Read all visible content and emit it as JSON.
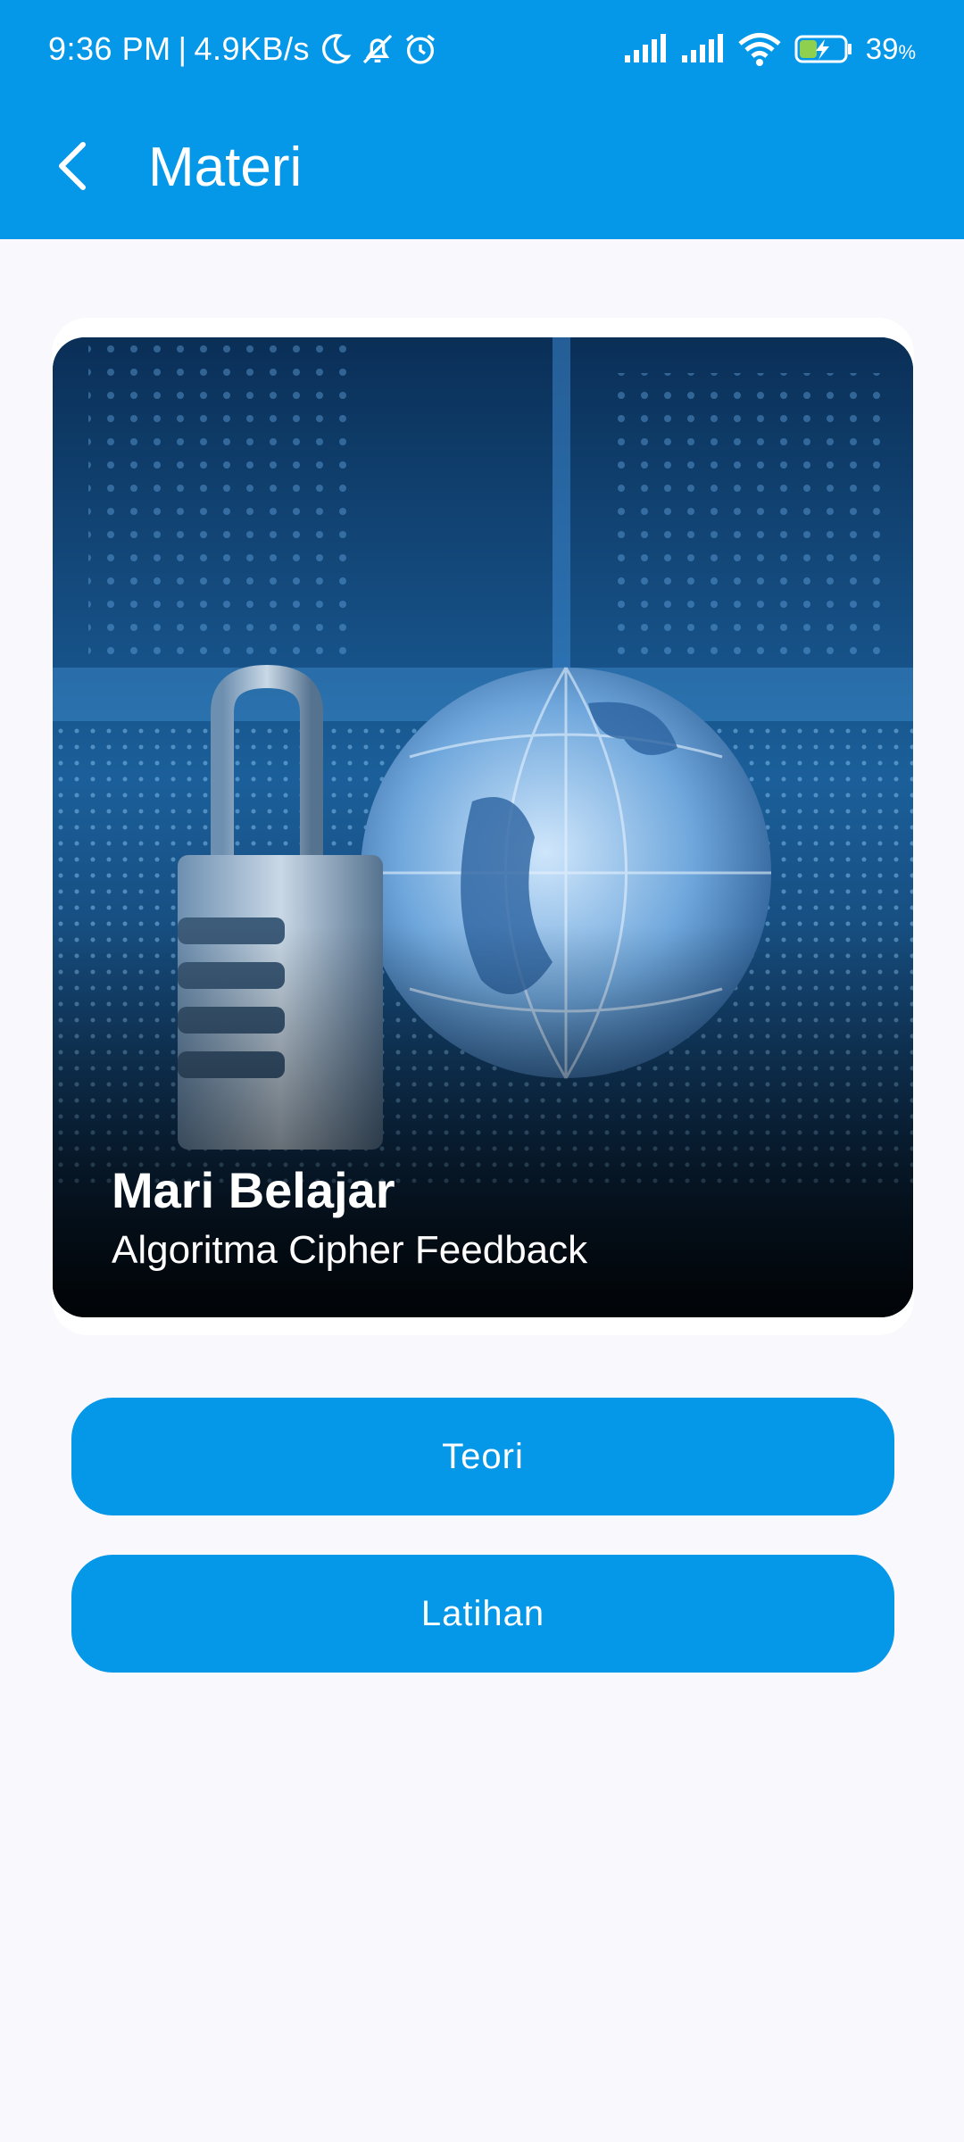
{
  "status_bar": {
    "time": "9:36 PM",
    "separator": "|",
    "net_speed": "4.9KB/s",
    "left_icons": [
      "moon-icon",
      "bell-off-icon",
      "alarm-icon"
    ],
    "right_icons": [
      "signal-icon",
      "signal-icon",
      "wifi-icon",
      "battery-charging-icon"
    ],
    "battery_percent": "39",
    "battery_unit": "%",
    "battery_level": 0.39
  },
  "app_bar": {
    "back_icon": "chevron-left-icon",
    "title": "Materi",
    "background": "#0597e8"
  },
  "hero": {
    "image": "padlock-and-globe-on-circuit-board",
    "title": "Mari Belajar",
    "subtitle": "Algoritma Cipher Feedback"
  },
  "actions": {
    "teori_label": "Teori",
    "latihan_label": "Latihan",
    "button_color": "#0597e8"
  }
}
